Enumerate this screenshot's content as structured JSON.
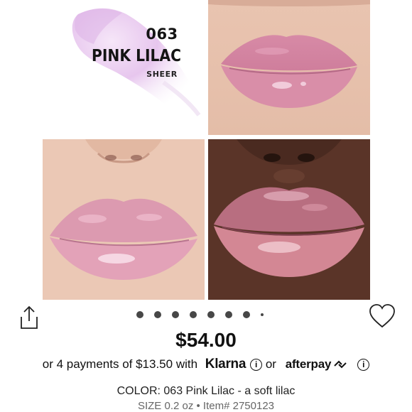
{
  "product_image": {
    "shade_code": "063",
    "shade_name": "PINK LILAC",
    "shade_finish": "SHEER",
    "swatch_color": "#e9cbee",
    "lip_color_light": "#d98ea8",
    "lip_color_deep": "#c46a86"
  },
  "carousel": {
    "dot_count": 8,
    "active_index": 0
  },
  "actions": {
    "share_icon": "share-icon",
    "favorite_icon": "heart-icon"
  },
  "price": {
    "amount": "$54.00"
  },
  "installments": {
    "prefix": "or 4 payments of ",
    "amount": "$13.50",
    "with": " with ",
    "klarna_brand": "Klarna",
    "or": " or ",
    "afterpay_brand": "afterpay",
    "info_glyph": "i"
  },
  "product_details": {
    "color_line": "COLOR: 063 Pink Lilac - a soft lilac",
    "size_line": "SIZE 0.2 oz • Item# 2750123"
  }
}
